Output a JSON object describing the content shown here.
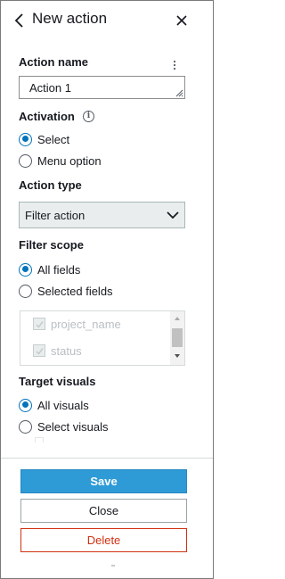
{
  "panel": {
    "title": "New action",
    "icons": {
      "back": "chevron-left-icon",
      "close": "close-icon",
      "more": "vertical-ellipsis-icon"
    }
  },
  "action_name": {
    "label": "Action name",
    "value": "Action 1"
  },
  "activation": {
    "label": "Activation",
    "info_glyph": "i",
    "options": [
      {
        "label": "Select",
        "selected": true
      },
      {
        "label": "Menu option",
        "selected": false
      }
    ]
  },
  "action_type": {
    "label": "Action type",
    "value": "Filter action"
  },
  "filter_scope": {
    "label": "Filter scope",
    "options": [
      {
        "label": "All fields",
        "selected": true
      },
      {
        "label": "Selected fields",
        "selected": false
      }
    ],
    "fields": [
      {
        "label": "project_name",
        "checked": true,
        "disabled": true
      },
      {
        "label": "status",
        "checked": true,
        "disabled": true
      }
    ]
  },
  "target_visuals": {
    "label": "Target visuals",
    "options": [
      {
        "label": "All visuals",
        "selected": true
      },
      {
        "label": "Select visuals",
        "selected": false
      }
    ]
  },
  "buttons": {
    "save": "Save",
    "close": "Close",
    "delete": "Delete"
  },
  "colors": {
    "accent": "#0073bb",
    "primary_button": "#2f9bd6",
    "danger": "#d13212",
    "text": "#16191f"
  }
}
